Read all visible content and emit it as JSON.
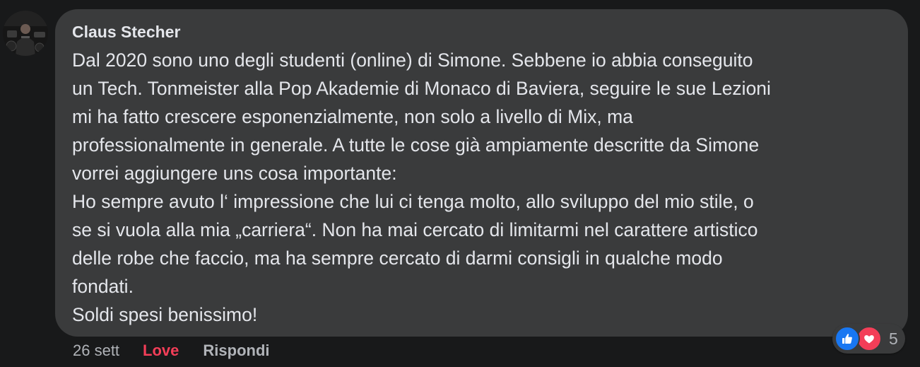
{
  "comment": {
    "author": "Claus Stecher",
    "lines": [
      "Dal 2020 sono uno degli studenti (online) di Simone. Sebbene io abbia conseguito",
      "un Tech. Tonmeister alla Pop Akademie di Monaco di Baviera, seguire le sue Lezioni",
      "mi ha fatto crescere esponenzialmente, non solo a livello di Mix, ma",
      "professionalmente in generale. A tutte le cose già ampiamente descritte da Simone",
      "vorrei aggiungere uns cosa importante:",
      "Ho sempre avuto l‘ impressione che lui ci tenga molto, allo sviluppo del mio stile, o",
      "se si vuola alla mia „carriera“. Non ha mai cercato di limitarmi nel carattere artistico",
      "delle robe che faccio, ma ha sempre cercato di darmi consigli in qualche modo",
      "fondati.",
      "Soldi spesi benissimo!"
    ]
  },
  "meta": {
    "time": "26 sett",
    "reaction_label": "Love",
    "reply_label": "Rispondi"
  },
  "reactions": {
    "icons": [
      "thumbs-up-icon",
      "heart-icon"
    ],
    "count": "5"
  },
  "colors": {
    "background": "#18191a",
    "bubble": "#3a3b3c",
    "text": "#e4e6eb",
    "secondary_text": "#b0b3b8",
    "love": "#f33e58",
    "like": "#1877f2"
  }
}
